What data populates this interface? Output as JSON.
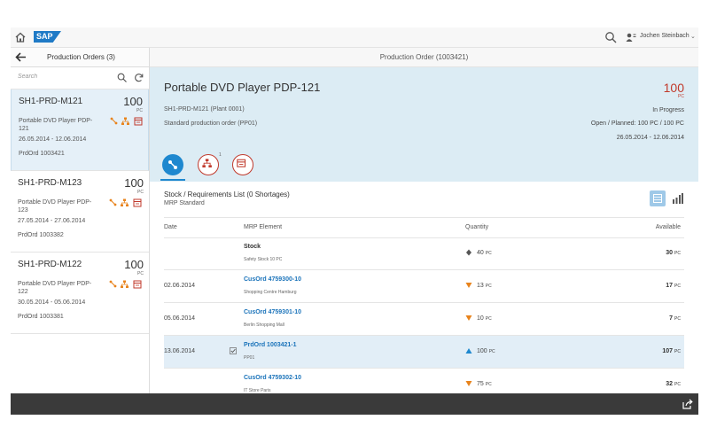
{
  "shell": {
    "logo": "SAP",
    "user": "Jochen Steinbach"
  },
  "master": {
    "title": "Production Orders (3)",
    "search_placeholder": "Search",
    "items": [
      {
        "title": "SH1-PRD-M121",
        "qty": "100",
        "unit": "PC",
        "desc": "Portable DVD Player PDP-121",
        "dates": "26.05.2014 - 12.06.2014",
        "order": "PrdOrd 1003421"
      },
      {
        "title": "SH1-PRD-M123",
        "qty": "100",
        "unit": "PC",
        "desc": "Portable DVD Player PDP-123",
        "dates": "27.05.2014 - 27.06.2014",
        "order": "PrdOrd 1003382"
      },
      {
        "title": "SH1-PRD-M122",
        "qty": "100",
        "unit": "PC",
        "desc": "Portable DVD Player PDP-122",
        "dates": "30.05.2014 - 05.06.2014",
        "order": "PrdOrd 1003381"
      }
    ]
  },
  "detail": {
    "header_title": "Production Order (1003421)",
    "object": {
      "title": "Portable DVD Player PDP-121",
      "qty": "100",
      "unit": "PC",
      "line1": "SH1-PRD-M121 (Plant 0001)",
      "line2": "Standard production order (PP01)",
      "status": "In Progress",
      "open_planned": "Open / Planned: 100 PC / 100 PC",
      "dates": "26.05.2014 - 12.06.2014"
    },
    "tabs": {
      "badge": "1"
    },
    "table": {
      "title": "Stock / Requirements List (0 Shortages)",
      "subtitle": "MRP Standard",
      "columns": {
        "date": "Date",
        "element": "MRP Element",
        "quantity": "Quantity",
        "available": "Available"
      },
      "rows": [
        {
          "date": "",
          "element": "Stock",
          "sub": "Safety Stock 10 PC",
          "qty": "40",
          "unit": "PC",
          "available": "30",
          "type": "stock"
        },
        {
          "date": "02.06.2014",
          "element": "CusOrd 4759300-10",
          "sub": "Shopping Centre Hamburg",
          "qty": "13",
          "unit": "PC",
          "available": "17",
          "type": "down"
        },
        {
          "date": "05.06.2014",
          "element": "CusOrd 4759301-10",
          "sub": "Berlin Shopping Mall",
          "qty": "10",
          "unit": "PC",
          "available": "7",
          "type": "down"
        },
        {
          "date": "13.06.2014",
          "element": "PrdOrd 1003421-1",
          "sub": "PP01",
          "qty": "100",
          "unit": "PC",
          "available": "107",
          "type": "up"
        },
        {
          "date": "",
          "element": "CusOrd 4759302-10",
          "sub": "IT Store Paris",
          "qty": "75",
          "unit": "PC",
          "available": "32",
          "type": "down"
        }
      ]
    }
  },
  "colors": {
    "accent": "#1e88cf",
    "critical": "#c13a2b",
    "warning": "#e8831c",
    "link": "#1a73ba"
  }
}
